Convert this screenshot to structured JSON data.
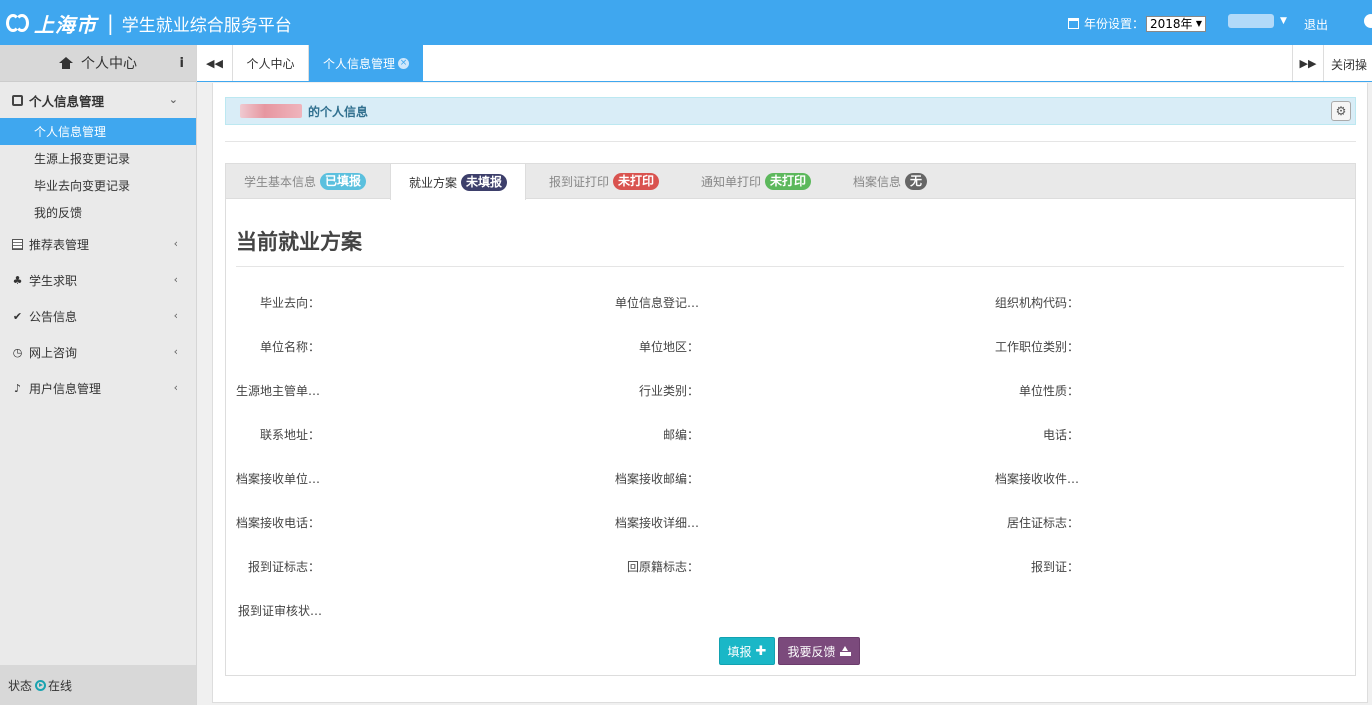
{
  "header": {
    "logo_city": "上海市",
    "logo_separator": "|",
    "platform_title": "学生就业综合服务平台",
    "year_label": "年份设置：",
    "year_value": "2018年",
    "logout": "退出"
  },
  "sidebar": {
    "title": "个人中心",
    "info_glyph": "i",
    "groups": [
      {
        "label": "个人信息管理",
        "icon": "archive-icon",
        "chevron": "⌄"
      },
      {
        "label": "推荐表管理",
        "icon": "document-icon",
        "chevron": "‹"
      },
      {
        "label": "学生求职",
        "icon": "tie-icon",
        "chevron": "‹"
      },
      {
        "label": "公告信息",
        "icon": "check-icon",
        "chevron": "‹"
      },
      {
        "label": "网上咨询",
        "icon": "clock-icon",
        "chevron": "‹"
      },
      {
        "label": "用户信息管理",
        "icon": "bell-icon",
        "chevron": "‹"
      }
    ],
    "sub_items": [
      {
        "label": "个人信息管理",
        "active": true
      },
      {
        "label": "生源上报变更记录",
        "active": false
      },
      {
        "label": "毕业去向变更记录",
        "active": false
      },
      {
        "label": "我的反馈",
        "active": false
      }
    ],
    "status_label": "状态",
    "status_value": "在线"
  },
  "tabs": {
    "nav_left": "◀◀",
    "nav_right": "▶▶",
    "items": [
      {
        "label": "个人中心"
      },
      {
        "label": "个人信息管理",
        "close": "×"
      }
    ],
    "close_ops": "关闭操"
  },
  "banner": {
    "text": "的个人信息",
    "gear": "⚙"
  },
  "card_tabs": [
    {
      "label": "学生基本信息",
      "badge": "已填报",
      "badge_color": "#5bc0de"
    },
    {
      "label": "就业方案",
      "badge": "未填报",
      "badge_color": "#3d3f6b"
    },
    {
      "label": "报到证打印",
      "badge": "未打印",
      "badge_color": "#d9534f"
    },
    {
      "label": "通知单打印",
      "badge": "未打印",
      "badge_color": "#5cb85c"
    },
    {
      "label": "档案信息",
      "badge": "无",
      "badge_color": "#666666"
    }
  ],
  "plan": {
    "title": "当前就业方案",
    "rows": [
      [
        "毕业去向：",
        "单位信息登记…",
        "组织机构代码："
      ],
      [
        "单位名称：",
        "单位地区：",
        "工作职位类别："
      ],
      [
        "生源地主管单…",
        "行业类别：",
        "单位性质："
      ],
      [
        "联系地址：",
        "邮编：",
        "电话："
      ],
      [
        "档案接收单位…",
        "档案接收邮编：",
        "档案接收收件…"
      ],
      [
        "档案接收电话：",
        "档案接收详细…",
        "居住证标志："
      ],
      [
        "报到证标志：",
        "回原籍标志：",
        "报到证："
      ],
      [
        "报到证审核状…"
      ]
    ]
  },
  "buttons": {
    "fill": "填报",
    "fill_icon": "✚",
    "feedback": "我要反馈"
  }
}
